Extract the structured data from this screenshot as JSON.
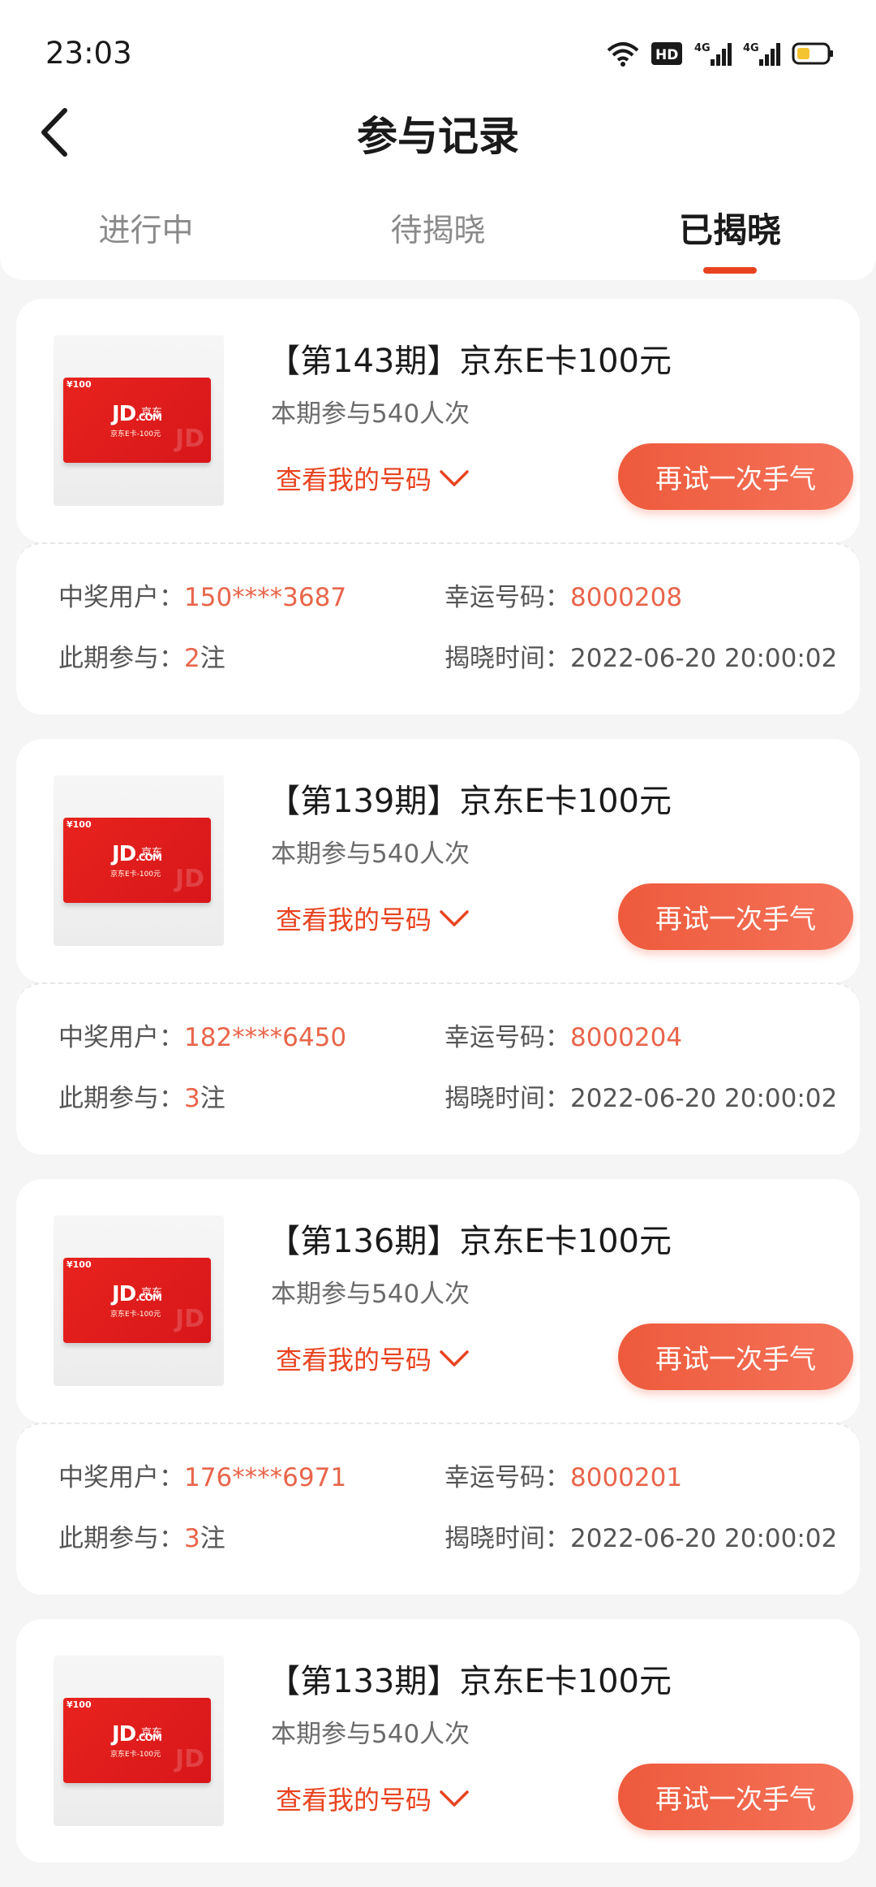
{
  "status": {
    "time": "23:03"
  },
  "header": {
    "title": "参与记录"
  },
  "tabs": [
    {
      "label": "进行中"
    },
    {
      "label": "待揭晓"
    },
    {
      "label": "已揭晓"
    }
  ],
  "labels": {
    "participants_prefix": "本期参与",
    "view_codes": "查看我的号码",
    "retry": "再试一次手气",
    "winner": "中奖用户：",
    "lucky": "幸运号码：",
    "entries": "此期参与：",
    "entries_unit": "注",
    "reveal": "揭晓时间："
  },
  "product_image": {
    "amount": "¥100",
    "logo": "JD",
    "logo_com": ".COM",
    "logo_cn": "京东",
    "sub": "京东E卡-100元",
    "watermark": "JD"
  },
  "records": [
    {
      "title": "【第143期】京东E卡100元",
      "participants": "本期参与540人次",
      "winner": "150****3687",
      "lucky": "8000208",
      "entries": "2",
      "reveal": "2022-06-20 20:00:02"
    },
    {
      "title": "【第139期】京东E卡100元",
      "participants": "本期参与540人次",
      "winner": "182****6450",
      "lucky": "8000204",
      "entries": "3",
      "reveal": "2022-06-20 20:00:02"
    },
    {
      "title": "【第136期】京东E卡100元",
      "participants": "本期参与540人次",
      "winner": "176****6971",
      "lucky": "8000201",
      "entries": "3",
      "reveal": "2022-06-20 20:00:02"
    },
    {
      "title": "【第133期】京东E卡100元",
      "participants": "本期参与540人次"
    }
  ],
  "colors": {
    "accent": "#e8431f",
    "button": "#ee5a3c",
    "highlight": "#e8654a"
  }
}
